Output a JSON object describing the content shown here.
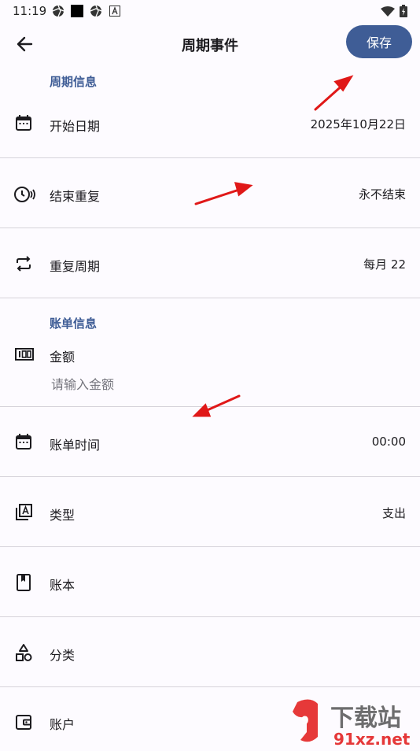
{
  "status_bar": {
    "time": "11:19"
  },
  "header": {
    "title": "周期事件",
    "save_label": "保存"
  },
  "sections": {
    "cycle_info": "周期信息",
    "bill_info": "账单信息"
  },
  "rows": {
    "start_date": {
      "label": "开始日期",
      "value": "2025年10月22日"
    },
    "end_repeat": {
      "label": "结束重复",
      "value": "永不结束"
    },
    "repeat_cycle": {
      "label": "重复周期",
      "value": "每月 22"
    },
    "amount": {
      "label": "金额",
      "placeholder": "请输入金额"
    },
    "bill_time": {
      "label": "账单时间",
      "value": "00:00"
    },
    "type": {
      "label": "类型",
      "value": "支出"
    },
    "ledger": {
      "label": "账本"
    },
    "category": {
      "label": "分类"
    },
    "account": {
      "label": "账户"
    }
  },
  "watermark": {
    "text1": "下载站",
    "text2": "91xz.net"
  },
  "colors": {
    "accent": "#3f5d96",
    "arrow": "#e01818",
    "divider": "#d6d3da"
  }
}
